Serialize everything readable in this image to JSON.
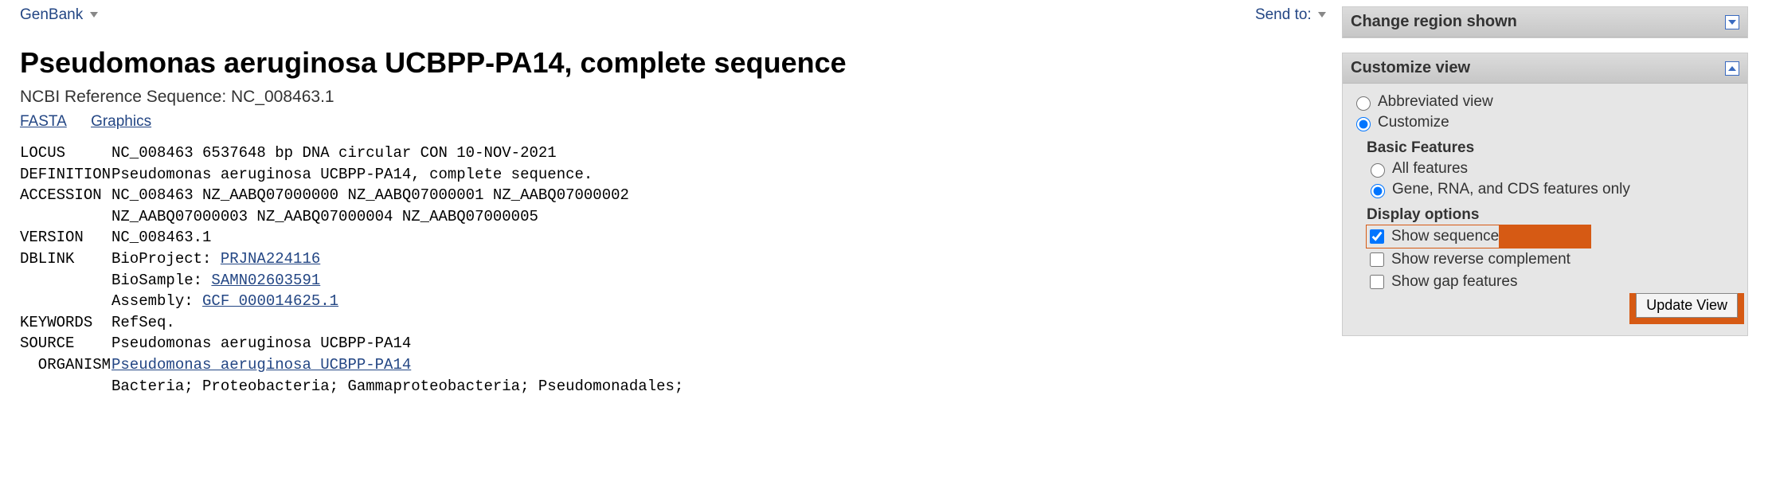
{
  "topbar": {
    "format_menu": "GenBank",
    "send_to": "Send to:"
  },
  "title": "Pseudomonas aeruginosa UCBPP-PA14, complete sequence",
  "subtitle": "NCBI Reference Sequence: NC_008463.1",
  "links": {
    "fasta": "FASTA",
    "graphics": "Graphics"
  },
  "record": {
    "locus_label": "LOCUS",
    "locus_value": "NC_008463            6537648 bp    DNA     circular CON 10-NOV-2021",
    "definition_label": "DEFINITION",
    "definition_value": "Pseudomonas aeruginosa UCBPP-PA14, complete sequence.",
    "accession_label": "ACCESSION",
    "accession_line1": "NC_008463 NZ_AABQ07000000 NZ_AABQ07000001 NZ_AABQ07000002",
    "accession_line2": "NZ_AABQ07000003 NZ_AABQ07000004 NZ_AABQ07000005",
    "version_label": "VERSION",
    "version_value": "NC_008463.1",
    "dblink_label": "DBLINK",
    "dblink_bioproject_prefix": "BioProject: ",
    "dblink_bioproject_link": "PRJNA224116",
    "dblink_biosample_prefix": "BioSample: ",
    "dblink_biosample_link": "SAMN02603591",
    "dblink_assembly_prefix": "Assembly: ",
    "dblink_assembly_link": "GCF_000014625.1",
    "keywords_label": "KEYWORDS",
    "keywords_value": "RefSeq.",
    "source_label": "SOURCE",
    "source_value": "Pseudomonas aeruginosa UCBPP-PA14",
    "organism_label": "  ORGANISM",
    "organism_link": "Pseudomonas aeruginosa UCBPP-PA14",
    "lineage": "Bacteria; Proteobacteria; Gammaproteobacteria; Pseudomonadales;"
  },
  "sidebar": {
    "region": {
      "title": "Change region shown"
    },
    "customize": {
      "title": "Customize view",
      "opt_abbrev": "Abbreviated view",
      "opt_custom": "Customize",
      "basic_title": "Basic Features",
      "opt_all": "All features",
      "opt_gene": "Gene, RNA, and CDS features only",
      "display_title": "Display options",
      "show_seq": "Show sequence",
      "show_rev": "Show reverse complement",
      "show_gap": "Show gap features",
      "update_btn": "Update View"
    }
  }
}
